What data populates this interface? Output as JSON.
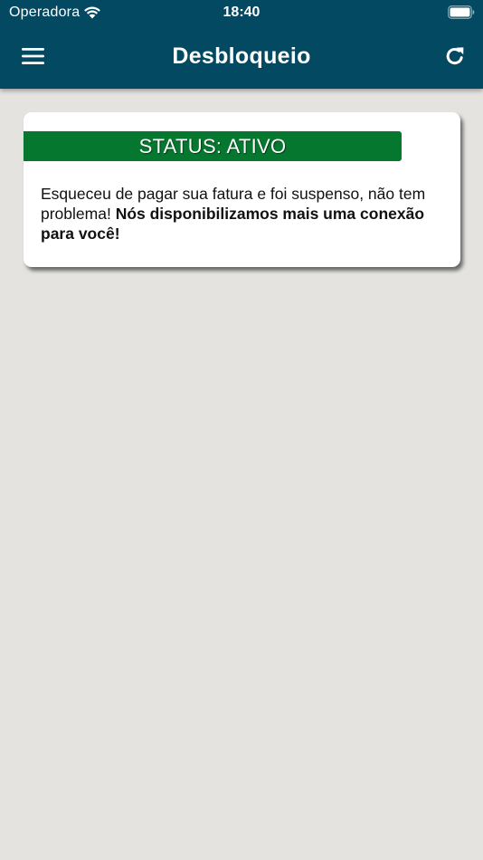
{
  "status_bar": {
    "carrier": "Operadora",
    "time": "18:40",
    "wifi_icon": "wifi-icon",
    "battery_icon": "battery-full-icon"
  },
  "nav": {
    "title": "Desbloqueio",
    "menu_icon": "hamburger-menu-icon",
    "refresh_icon": "refresh-icon",
    "color": "#034961"
  },
  "card": {
    "status_label": "STATUS: ATIVO",
    "status_color": "#06772f",
    "message_regular": "Esqueceu de pagar sua fatura e foi suspenso, não tem problema! ",
    "message_bold": "Nós disponibilizamos mais uma conexão para você!"
  },
  "colors": {
    "background": "#e4e3df",
    "card": "#ffffff"
  }
}
